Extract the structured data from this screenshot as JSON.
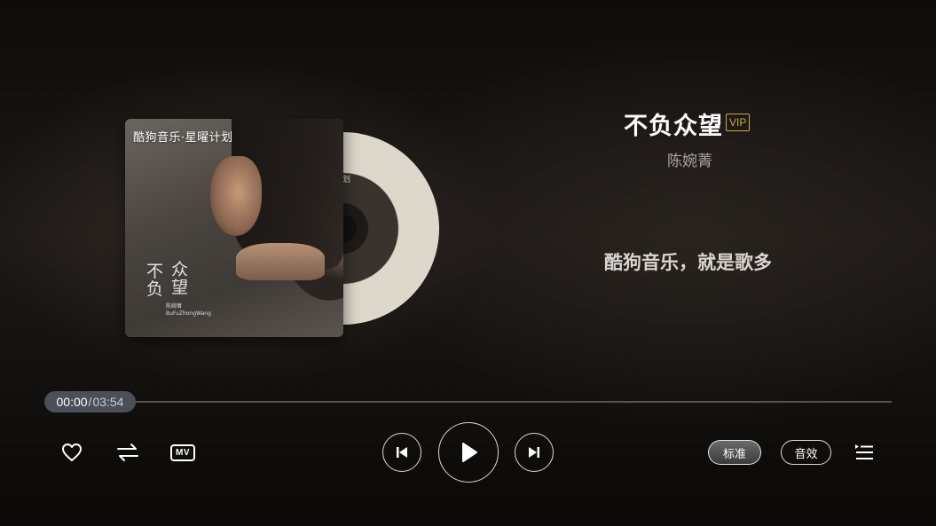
{
  "album": {
    "cover_brand": "酷狗音乐·星曜计划",
    "cover_title_a": "不负",
    "cover_title_b": "众望",
    "cover_artist_line1": "陈婉菁",
    "cover_artist_line2": "BuFuZhongWang",
    "disc_label_fragment": "划"
  },
  "song": {
    "title": "不负众望",
    "vip_label": "VIP",
    "artist": "陈婉菁",
    "lyric_line": "酷狗音乐，就是歌多"
  },
  "progress": {
    "current": "00:00",
    "separator": "/",
    "total": "03:54",
    "fraction": 0
  },
  "controls": {
    "left": [
      {
        "name": "favorite-button",
        "icon": "heart-icon"
      },
      {
        "name": "play-mode-button",
        "icon": "repeat-list-icon"
      },
      {
        "name": "mv-button",
        "icon": "mv-icon",
        "label": "MV"
      }
    ],
    "center": [
      {
        "name": "previous-button",
        "icon": "skip-previous-icon"
      },
      {
        "name": "play-button",
        "icon": "play-icon"
      },
      {
        "name": "next-button",
        "icon": "skip-next-icon"
      }
    ],
    "quality_label": "标准",
    "effect_label": "音效",
    "playlist_icon": "playlist-icon"
  },
  "colors": {
    "vip": "#d0a84c",
    "time_pill": "#4a4f58"
  }
}
